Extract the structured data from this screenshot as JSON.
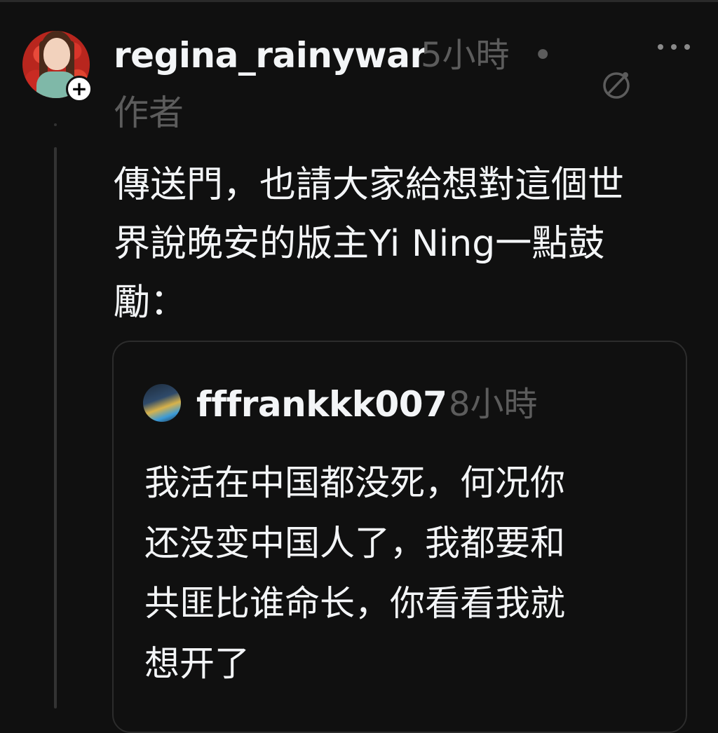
{
  "post": {
    "username": "regina_rainywar",
    "time": "5小時",
    "separator": "•",
    "author_tag": "作者",
    "follow_symbol": "+",
    "lines": [
      "傳送門，也請大家給想對這個世",
      "界說晚安的版主Yi Ning一點鼓",
      "勵："
    ]
  },
  "quote": {
    "username": "fffrankkk007",
    "time": "8小時",
    "lines": [
      "我活在中国都没死，何况你",
      "还没变中国人了，我都要和",
      "共匪比谁命长，你看看我就",
      "想开了"
    ]
  },
  "icons": {
    "more": "more-horizontal-icon",
    "translate": "translate-icon",
    "follow": "plus-icon"
  },
  "colors": {
    "background": "#101010",
    "text": "#f3f5f7",
    "muted": "#5c5c5c",
    "border": "#2c2c2c"
  }
}
